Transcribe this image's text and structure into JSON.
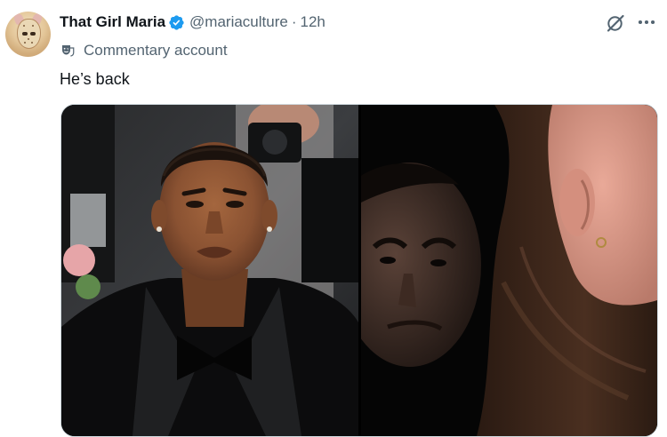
{
  "tweet": {
    "display_name": "That Girl Maria",
    "handle": "@mariaculture",
    "separator": "·",
    "time": "12h",
    "label": "Commentary account",
    "text": "He’s back"
  },
  "icons": {
    "verified": "verified-badge-icon",
    "grok": "grok-icon",
    "more": "more-options-icon",
    "label": "theater-masks-icon"
  },
  "colors": {
    "verified": "#1d9bf0",
    "secondary_text": "#536471",
    "primary_text": "#0f1419"
  },
  "media": {
    "count": 2
  }
}
